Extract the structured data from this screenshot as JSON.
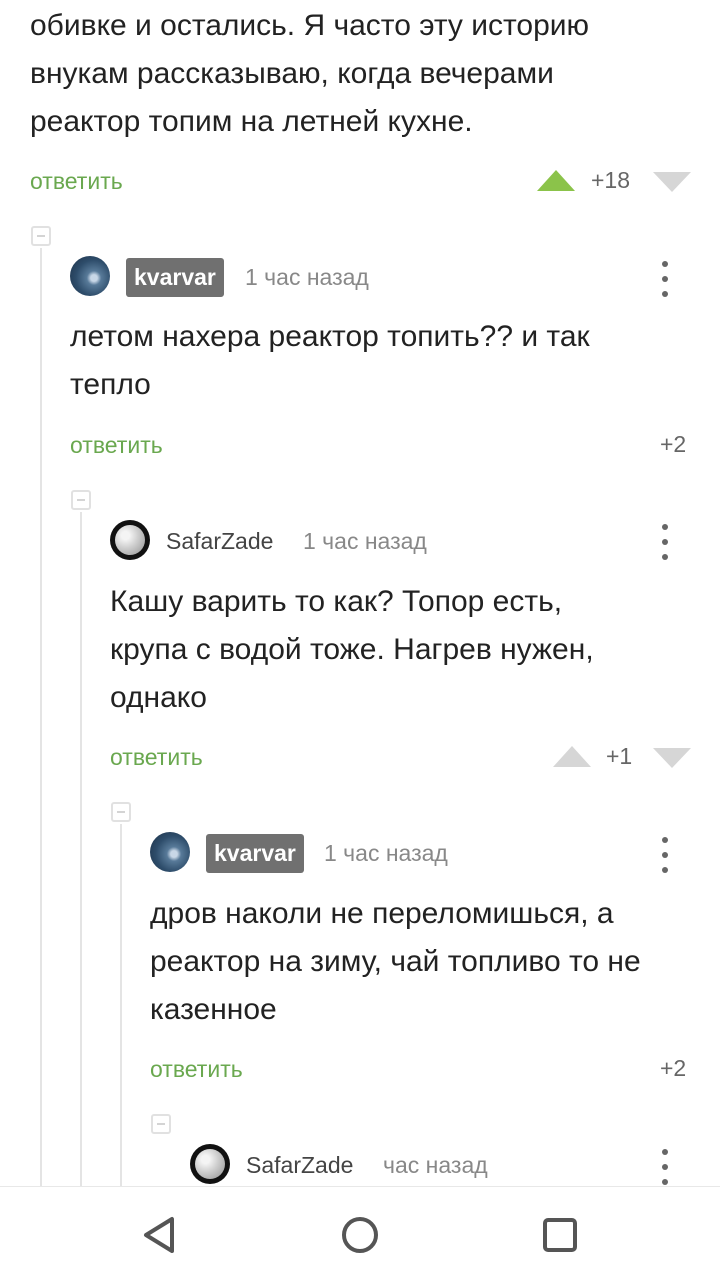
{
  "top_comment": {
    "text_lines": [
      "обивке и остались. Я часто эту историю",
      "внукам рассказываю, когда вечерами",
      "реактор топим на летней кухне."
    ],
    "reply_label": "ответить",
    "score": "+18"
  },
  "comments": [
    {
      "user": "kvarvar",
      "time": "1 час назад",
      "text_lines": [
        "летом нахера реактор топить?? и так",
        "тепло"
      ],
      "reply_label": "ответить",
      "score": "+2"
    },
    {
      "user": "SafarZade",
      "time": "1 час назад",
      "text_lines": [
        "Кашу варить то как? Топор есть,",
        "крупа с водой тоже. Нагрев нужен,",
        "однако"
      ],
      "reply_label": "ответить",
      "score": "+1"
    },
    {
      "user": "kvarvar",
      "time": "1 час назад",
      "text_lines": [
        "дров наколи не переломишься, а",
        "реактор на зиму, чай топливо то не",
        "казенное"
      ],
      "reply_label": "ответить",
      "score": "+2"
    },
    {
      "user": "SafarZade",
      "time": "час назад"
    }
  ],
  "colors": {
    "reply": "#6aa84f",
    "upvote_active": "#8bc34a",
    "vote_inactive": "#d6d6d6",
    "badge": "#707070"
  },
  "icons": [
    "upvote-icon",
    "downvote-icon",
    "more-icon",
    "collapse-icon",
    "back-icon",
    "home-icon",
    "recents-icon"
  ]
}
